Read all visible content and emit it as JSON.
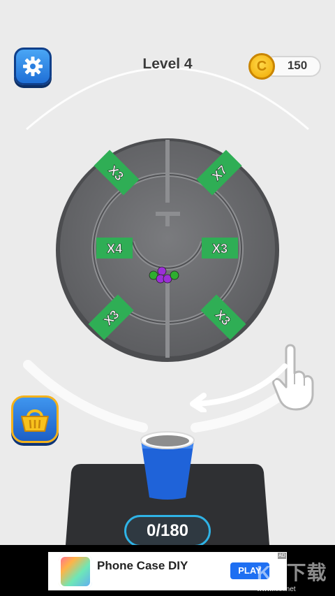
{
  "header": {
    "level_title": "Level 4",
    "coin_count": "150",
    "coin_glyph": "C"
  },
  "wheel": {
    "multipliers": {
      "outer_top_left": "X3",
      "outer_top_right": "X7",
      "inner_left": "X4",
      "inner_right": "X3",
      "outer_bottom_left": "X3",
      "outer_bottom_right": "X3"
    },
    "ball_colors": [
      "#2fae2f",
      "#9b2fd6",
      "#9b2fd6",
      "#9b2fd6",
      "#2fae2f"
    ]
  },
  "counter": {
    "text": "0/180"
  },
  "ad": {
    "title": "Phone Case DIY",
    "play_label": "PLAY",
    "badge": "AD"
  },
  "watermark": {
    "logo": "KK下载",
    "url": "www.kkx.net"
  },
  "icons": {
    "settings": "gear-icon",
    "coin": "coin-icon",
    "basket": "basket-icon",
    "hand": "pointing-hand-icon",
    "cup": "blue-cup"
  },
  "colors": {
    "background": "#ebebeb",
    "wheel": "#6a6b6d",
    "multiplier_green": "#2fae55",
    "cup_blue": "#1f63d9",
    "accent_blue": "#2fb3e6"
  }
}
